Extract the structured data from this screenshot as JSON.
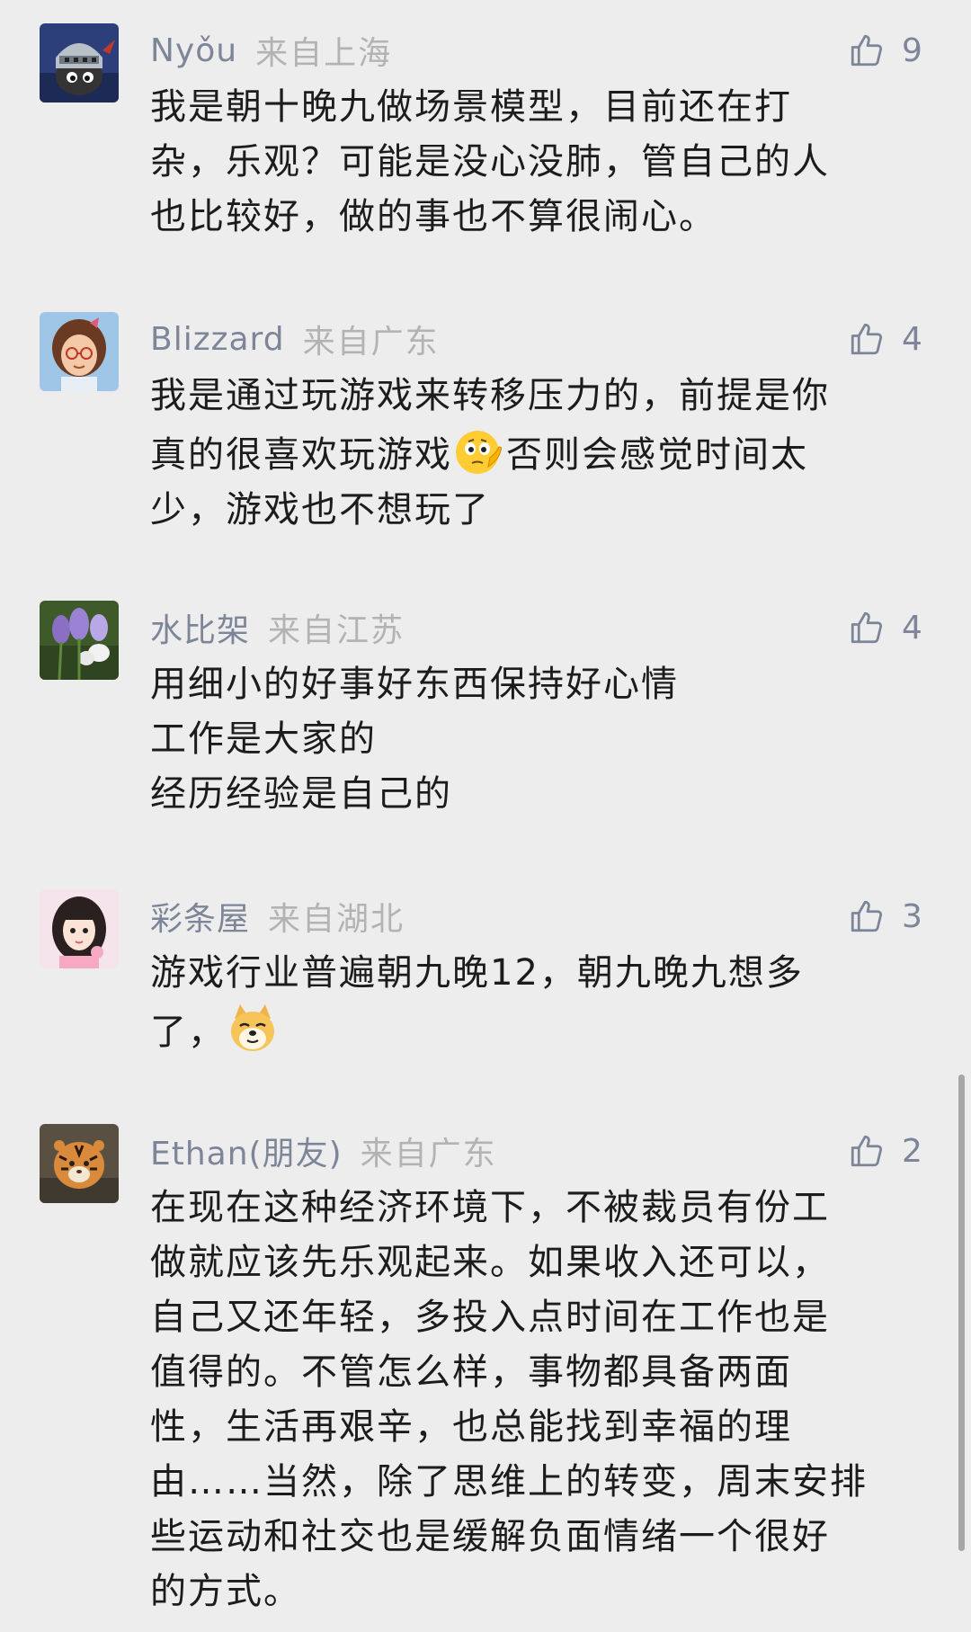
{
  "comments": [
    {
      "author": "Nyǒu",
      "location": "来自上海",
      "likes": "9",
      "lines": [
        "我是朝十晚九做场景模型，目前还在打",
        "杂，乐观？可能是没心没肺，管自己的人",
        "也比较好，做的事也不算很闹心。"
      ]
    },
    {
      "author": "Blizzard",
      "location": "来自广东",
      "likes": "4",
      "line1": "我是通过玩游戏来转移压力的，前提是你",
      "line2a": "真的很喜欢玩游戏",
      "line2b": "否则会感觉时间太",
      "line3": "少，游戏也不想玩了"
    },
    {
      "author": "水比架",
      "location": "来自江苏",
      "likes": "4",
      "lines": [
        "用细小的好事好东西保持好心情",
        "工作是大家的",
        "经历经验是自己的"
      ]
    },
    {
      "author": "彩条屋",
      "location": "来自湖北",
      "likes": "3",
      "line1": "游戏行业普遍朝九晚12，朝九晚九想多",
      "line2": "了，"
    },
    {
      "author": "Ethan(朋友)",
      "location": "来自广东",
      "likes": "2",
      "lines": [
        "在现在这种经济环境下，不被裁员有份工",
        "做就应该先乐观起来。如果收入还可以，",
        "自己又还年轻，多投入点时间在工作也是",
        "值得的。不管怎么样，事物都具备两面",
        "性，生活再艰辛，也总能找到幸福的理",
        "由……当然，除了思维上的转变，周末安排",
        "些运动和社交也是缓解负面情绪一个很好",
        "的方式。"
      ]
    }
  ],
  "icons": {
    "like": "thumbs-up-icon",
    "emoji_thinking": "thinking-face-emoji",
    "emoji_dog": "doge-emoji"
  },
  "colors": {
    "background": "#ededed",
    "author": "#7d8598",
    "location": "#b3b3b3",
    "text": "#1c1c1c"
  }
}
